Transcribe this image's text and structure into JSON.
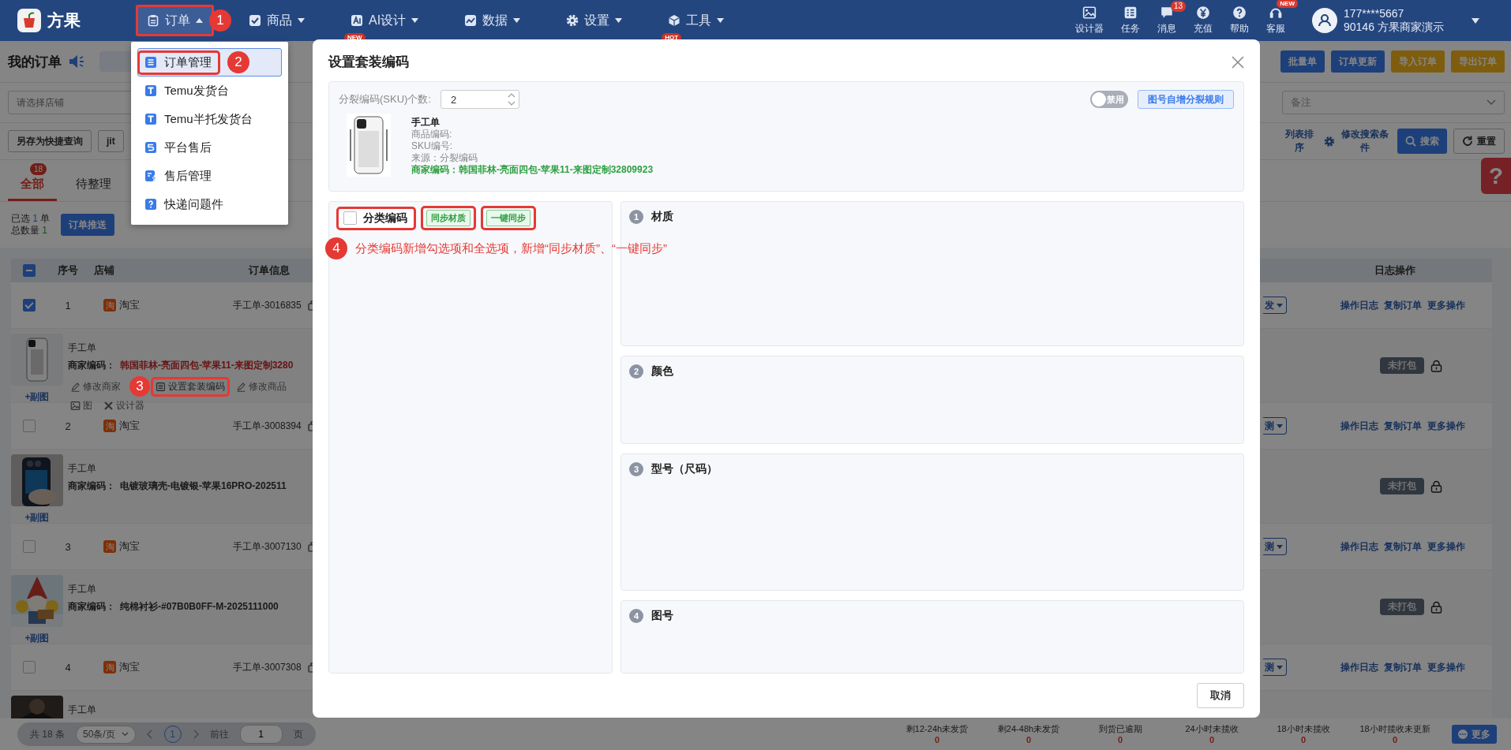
{
  "app": {
    "name": "方果"
  },
  "nav": {
    "items": [
      {
        "label": "订单",
        "open": true,
        "callout": "1"
      },
      {
        "label": "商品",
        "open": false
      },
      {
        "label": "AI设计",
        "open": false,
        "badge": "NEW"
      },
      {
        "label": "数据",
        "open": false
      },
      {
        "label": "设置",
        "open": false
      },
      {
        "label": "工具",
        "open": false,
        "badge": "HOT"
      }
    ],
    "tools": [
      {
        "label": "设计器"
      },
      {
        "label": "任务"
      },
      {
        "label": "消息",
        "count": "13"
      },
      {
        "label": "充值"
      },
      {
        "label": "帮助"
      },
      {
        "label": "客服",
        "badge": "NEW"
      }
    ],
    "user": {
      "phone": "177****5667",
      "account": "90146 方果商家演示"
    }
  },
  "menu": {
    "items": [
      {
        "label": "订单管理",
        "selected": true,
        "callout": "2"
      },
      {
        "label": "Temu发货台",
        "selected": false
      },
      {
        "label": "Temu半托发货台",
        "selected": false
      },
      {
        "label": "平台售后",
        "selected": false
      },
      {
        "label": "售后管理",
        "selected": false
      },
      {
        "label": "快递问题件",
        "selected": false
      }
    ]
  },
  "page": {
    "title": "我的订单",
    "actions": [
      {
        "label": "批量单",
        "kind": "primary"
      },
      {
        "label": "订单更新",
        "kind": "primary"
      },
      {
        "label": "导入订单",
        "kind": "warning"
      },
      {
        "label": "导出订单",
        "kind": "warning"
      }
    ],
    "shop_select": {
      "placeholder": "请选择店铺"
    },
    "remark_select": {
      "placeholder": "备注"
    },
    "quick": [
      "另存为快捷查询",
      "jit"
    ],
    "list_sort": "列表排序",
    "edit_filters": "修改搜索条件",
    "search": "搜索",
    "reset": "重置"
  },
  "tabs": [
    {
      "label": "全部",
      "badge": "18",
      "selected": true
    },
    {
      "label": "待整理",
      "selected": false
    }
  ],
  "summary": {
    "selected_label": "已选",
    "selected_count": "1",
    "selected_unit": "单",
    "total_label": "总数量",
    "total_count": "1",
    "push": "订单推送"
  },
  "help_tab": "?",
  "table": {
    "indeterminate": true,
    "columns": [
      "序号",
      "店铺",
      "订单信息"
    ],
    "log_column": "日志操作"
  },
  "orders": [
    {
      "index": "1",
      "checked": true,
      "shop_mark": "淘",
      "shop": "淘宝",
      "order_no": "手工单-3016835",
      "status": "发",
      "links": [
        "操作日志",
        "复制订单",
        "更多操作"
      ],
      "pack": "未打包",
      "product": {
        "name": "手工单",
        "code_label": "商家编码：",
        "code": "韩国菲林-亮面四包-苹果11-来图定制3280",
        "code_alert": true,
        "extra": "+副图",
        "actions": [
          {
            "label": "修改商家"
          },
          {
            "label": "设置套装编码",
            "callout": "3"
          },
          {
            "label": "修改商品"
          },
          {
            "label": "图"
          },
          {
            "label": "设计器"
          }
        ]
      }
    },
    {
      "index": "2",
      "checked": false,
      "shop_mark": "淘",
      "shop": "淘宝",
      "order_no": "手工单-3008394",
      "status": "测",
      "links": [
        "操作日志",
        "复制订单",
        "更多操作"
      ],
      "pack": "未打包",
      "product": {
        "name": "手工单",
        "code_label": "商家编码：",
        "code": "电镀玻璃壳-电镀银-苹果16PRO-202511",
        "code_alert": false,
        "extra": "+副图"
      }
    },
    {
      "index": "3",
      "checked": false,
      "shop_mark": "淘",
      "shop": "淘宝",
      "order_no": "手工单-3007130",
      "status": "测",
      "links": [
        "操作日志",
        "复制订单",
        "更多操作"
      ],
      "pack": "未打包",
      "product": {
        "name": "手工单",
        "code_label": "商家编码：",
        "code": "纯棉衬衫-#07B0B0FF-M-2025111000",
        "code_alert": false,
        "extra": "+副图"
      }
    },
    {
      "index": "4",
      "checked": false,
      "shop_mark": "淘",
      "shop": "淘宝",
      "order_no": "手工单-3007308",
      "status": "测",
      "links": [
        "操作日志",
        "复制订单",
        "更多操作"
      ],
      "product": {
        "name": "手工单"
      }
    }
  ],
  "footer": {
    "total": "共 18 条",
    "page_size": "50条/页",
    "page": "1",
    "goto": "前往",
    "goto_value": "1",
    "page_unit": "页",
    "stats": [
      {
        "label": "剩12-24h未发货",
        "value": "0"
      },
      {
        "label": "剩24-48h未发货",
        "value": "0"
      },
      {
        "label": "到货已逾期",
        "value": "0"
      },
      {
        "label": "24小时未揽收",
        "value": "0"
      },
      {
        "label": "18小时未揽收",
        "value": "0"
      },
      {
        "label": "18小时揽收未更新",
        "value": "0"
      }
    ],
    "more": "更多"
  },
  "modal": {
    "title": "设置套装编码",
    "count_label": "分裂编码(SKU)个数:",
    "count_value": "2",
    "toggle": {
      "label": "禁用",
      "on": false
    },
    "rule_button": "图号自增分裂规则",
    "product": {
      "name": "手工单",
      "lines": [
        "商品编码:",
        "SKU编号:",
        "来源：分裂编码"
      ],
      "code": "商家编码：韩国菲林-亮面四包-苹果11-来图定制32809923"
    },
    "category": {
      "label": "分类编码",
      "checked": false,
      "buttons": [
        "同步材质",
        "一键同步"
      ]
    },
    "note": {
      "number": "4",
      "text": "分类编码新增勾选项和全选项，新增“同步材质”、“一键同步”"
    },
    "sections": [
      {
        "number": "1",
        "title": "材质"
      },
      {
        "number": "2",
        "title": "颜色"
      },
      {
        "number": "3",
        "title": "型号（尺码）"
      },
      {
        "number": "4",
        "title": "图号"
      }
    ],
    "cancel": "取消"
  }
}
